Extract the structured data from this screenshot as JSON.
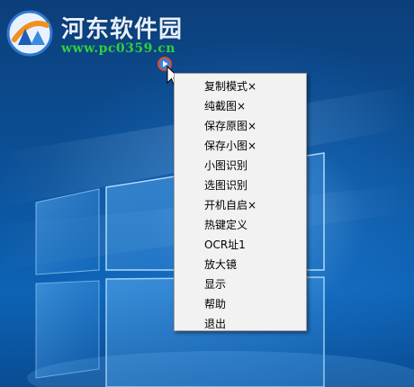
{
  "watermark": {
    "title": "河东软件园",
    "url": "www.pc0359.cn"
  },
  "context_menu": {
    "items": [
      {
        "label": "复制模式×"
      },
      {
        "label": "纯截图×"
      },
      {
        "label": "保存原图×"
      },
      {
        "label": "保存小图×"
      },
      {
        "label": "小图识别"
      },
      {
        "label": "选图识别"
      },
      {
        "label": "开机自启×"
      },
      {
        "label": "热键定义"
      },
      {
        "label": "OCR址1"
      },
      {
        "label": "放大镜"
      },
      {
        "label": "显示"
      },
      {
        "label": "帮助"
      },
      {
        "label": "退出"
      }
    ]
  },
  "colors": {
    "desktop": "#0d63b6",
    "menu_background": "#f2f2f2",
    "watermark_url": "#2fcf3f"
  },
  "icons": [
    "app-tray-icon",
    "mouse-cursor-icon",
    "site-logo-icon"
  ]
}
